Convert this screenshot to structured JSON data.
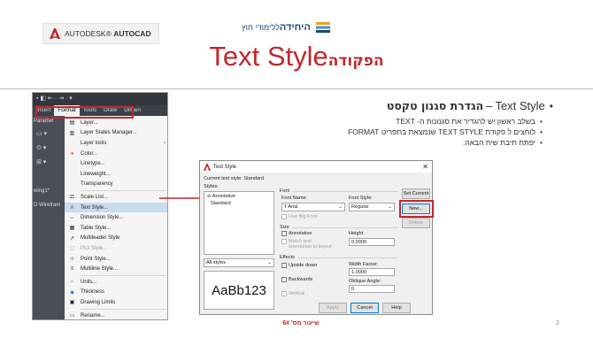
{
  "header": {
    "autodesk_logo": {
      "brand": "AUTODESK",
      "product": "AUTOCAD"
    },
    "unit_logo": {
      "name": "היחידה",
      "subtitle": "ללימודי חוץ"
    },
    "title_english": "Text Style",
    "title_hebrew": "הפקודה"
  },
  "menu_screenshot": {
    "quick_access": "▪ ◧ ⇤ · ⇥ · ▾",
    "menu_bar": [
      "Insert",
      "Format",
      "Tools",
      "Draw",
      "Dimen"
    ],
    "active_menu": "Format",
    "left_panel_labels": [
      "Paramet",
      "wing1*",
      "D Wirefram"
    ],
    "items": [
      {
        "label": "Layer...",
        "icon": "layer-icon",
        "disabled": false,
        "has_submenu": false
      },
      {
        "label": "Layer States Manager...",
        "icon": "layer-states-icon",
        "disabled": false,
        "has_submenu": false
      },
      {
        "label": "Layer tools",
        "icon": "",
        "disabled": false,
        "has_submenu": true
      },
      {
        "label": "Color...",
        "icon": "color-icon",
        "disabled": false,
        "has_submenu": false
      },
      {
        "label": "Linetype...",
        "icon": "",
        "disabled": false,
        "has_submenu": false
      },
      {
        "label": "Lineweight...",
        "icon": "",
        "disabled": false,
        "has_submenu": false
      },
      {
        "label": "Transparency",
        "icon": "",
        "disabled": false,
        "has_submenu": false
      },
      {
        "label": "Scale List...",
        "icon": "scale-list-icon",
        "disabled": false,
        "has_submenu": false
      },
      {
        "label": "Text Style...",
        "icon": "text-style-icon",
        "disabled": false,
        "has_submenu": false,
        "highlighted": true
      },
      {
        "label": "Dimension Style...",
        "icon": "dimension-style-icon",
        "disabled": false,
        "has_submenu": false
      },
      {
        "label": "Table Style...",
        "icon": "table-style-icon",
        "disabled": false,
        "has_submenu": false
      },
      {
        "label": "Multileader Style",
        "icon": "multileader-style-icon",
        "disabled": false,
        "has_submenu": false
      },
      {
        "label": "Plot Style...",
        "icon": "plot-style-icon",
        "disabled": true,
        "has_submenu": false
      },
      {
        "label": "Point Style...",
        "icon": "point-style-icon",
        "disabled": false,
        "has_submenu": false
      },
      {
        "label": "Multiline Style...",
        "icon": "multiline-style-icon",
        "disabled": false,
        "has_submenu": false
      },
      {
        "label": "Units...",
        "icon": "units-icon",
        "disabled": false,
        "has_submenu": false
      },
      {
        "label": "Thickness",
        "icon": "thickness-icon",
        "disabled": false,
        "has_submenu": false
      },
      {
        "label": "Drawing Limits",
        "icon": "drawing-limits-icon",
        "disabled": false,
        "has_submenu": false
      },
      {
        "label": "Rename...",
        "icon": "rename-icon",
        "disabled": false,
        "has_submenu": false
      }
    ]
  },
  "bullets": {
    "main_english": "Text Style",
    "main_dash": "–",
    "main_hebrew": "הגדרת סגנון טקסט",
    "sub": [
      "בשלב ראשון יש להגדיר את סגנונות ה- TEXT",
      "לוחצים ל פקודת TEXT STYLE שנמצאת בתפריט FORMAT",
      "יפתח תיבת שיח הבאה:"
    ]
  },
  "dialog": {
    "title": "Text Style",
    "close_glyph": "✕",
    "current_style_label": "Current text style:  Standard",
    "styles_label": "Styles:",
    "styles": [
      {
        "name": "Annotative",
        "icon": "annotative-icon"
      },
      {
        "name": "Standard",
        "icon": ""
      }
    ],
    "styles_filter": "All styles",
    "preview_text": "AaBb123",
    "font_group_label": "Font",
    "font_name_label": "Font Name:",
    "font_name_value": "Arial",
    "font_style_label": "Font Style:",
    "font_style_value": "Regular",
    "use_big_font_label": "Use Big Font",
    "size_group_label": "Size",
    "annotative_label": "Annotative",
    "match_orientation_label": "Match text orientation to layout",
    "height_label": "Height",
    "height_value": "0.0000",
    "effects_group_label": "Effects",
    "upside_down_label": "Upside down",
    "backwards_label": "Backwards",
    "vertical_label": "Vertical",
    "width_factor_label": "Width Factor:",
    "width_factor_value": "1.0000",
    "oblique_angle_label": "Oblique Angle:",
    "oblique_angle_value": "0",
    "buttons": {
      "set_current": "Set Current",
      "new": "New...",
      "delete": "Delete",
      "apply": "Apply",
      "cancel": "Cancel",
      "help": "Help"
    }
  },
  "footer": {
    "lesson": "שיעור מס' 6#",
    "slide_number": "2"
  },
  "colors": {
    "accent_red": "#c0282d",
    "menu_highlight": "#c8dcf2",
    "brand_blue": "#1e4a7a"
  }
}
